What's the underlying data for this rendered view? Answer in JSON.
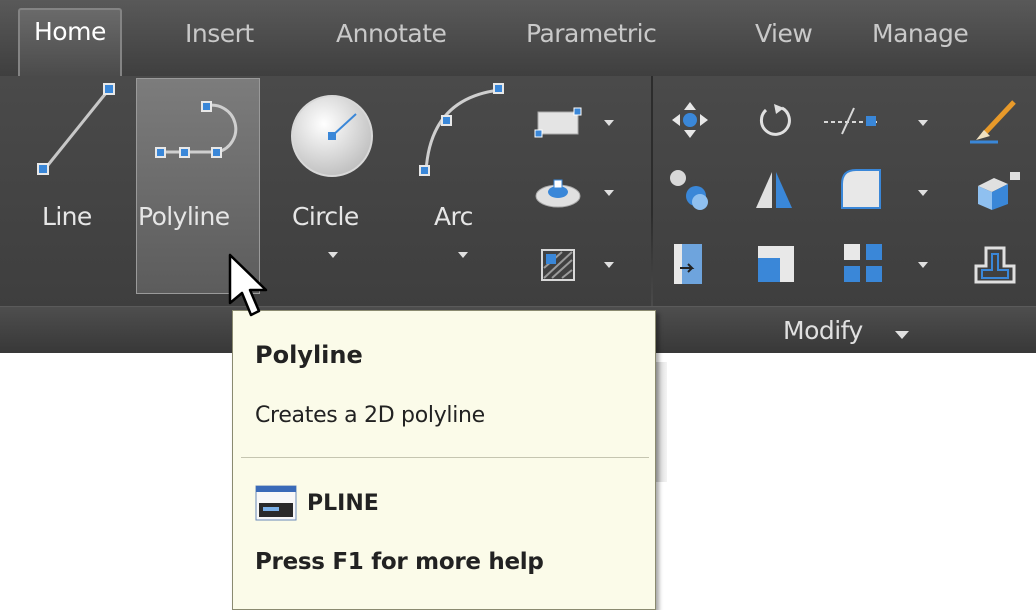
{
  "tabs": [
    {
      "label": "Home",
      "active": true
    },
    {
      "label": "Insert",
      "active": false
    },
    {
      "label": "Annotate",
      "active": false
    },
    {
      "label": "Parametric",
      "active": false
    },
    {
      "label": "View",
      "active": false
    },
    {
      "label": "Manage",
      "active": false
    }
  ],
  "draw_tools": {
    "line": "Line",
    "polyline": "Polyline",
    "circle": "Circle",
    "arc": "Arc"
  },
  "panels": {
    "modify": "Modify"
  },
  "tooltip": {
    "title": "Polyline",
    "description": "Creates a 2D polyline",
    "command": "PLINE",
    "help": "Press F1 for more help"
  },
  "icons": [
    "line-icon",
    "polyline-icon",
    "circle-icon",
    "arc-icon",
    "rectangle-icon",
    "hatch-icon",
    "boundary-icon",
    "move-icon",
    "rotate-icon",
    "trim-icon",
    "erase-icon",
    "copy-icon",
    "mirror-icon",
    "fillet-icon",
    "explode-icon",
    "stretch-icon",
    "scale-icon",
    "array-icon",
    "offset-icon",
    "mouse-cursor-icon",
    "command-icon"
  ],
  "colors": {
    "ribbon_bg": "#3c3c3c",
    "tab_bg": "#4a4a4a",
    "tooltip_bg": "#fbfbe9",
    "accent_blue": "#3a87d8"
  }
}
